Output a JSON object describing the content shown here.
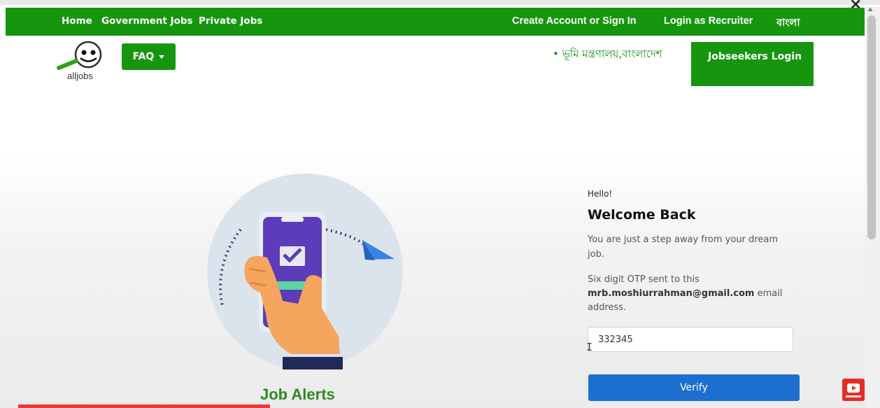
{
  "nav": {
    "left_links": [
      "Home",
      "Government Jobs",
      "Private Jobs"
    ],
    "right_links": [
      "Create Account or Sign In",
      "Login as Recruiter",
      "বাংলা"
    ]
  },
  "faq": {
    "label": "FAQ"
  },
  "logo": {
    "text": "alljobs"
  },
  "marquee": {
    "text": "• ভূমি মন্ত্রণালয়,বাংলাদেশ"
  },
  "jobseekers_login": {
    "label": "Jobseekers Login"
  },
  "login_panel": {
    "greeting": "Hello!",
    "title": "Welcome Back",
    "description": "You are just a step away from your dream job.",
    "otp_prefix": "Six digit OTP sent to this",
    "email": "mrb.moshiurrahman@gmail.com",
    "otp_suffix": "email address.",
    "otp_value": "332345",
    "verify_label": "Verify"
  },
  "illustration": {
    "caption": "Job Alerts"
  },
  "colors": {
    "brand_green": "#16960f",
    "verify_blue": "#1c6fcf",
    "youtube_red": "#e52d27"
  },
  "icons": [
    "close-icon",
    "caret-down-icon",
    "phone-envelope-illustration",
    "youtube-subscribe-icon"
  ]
}
